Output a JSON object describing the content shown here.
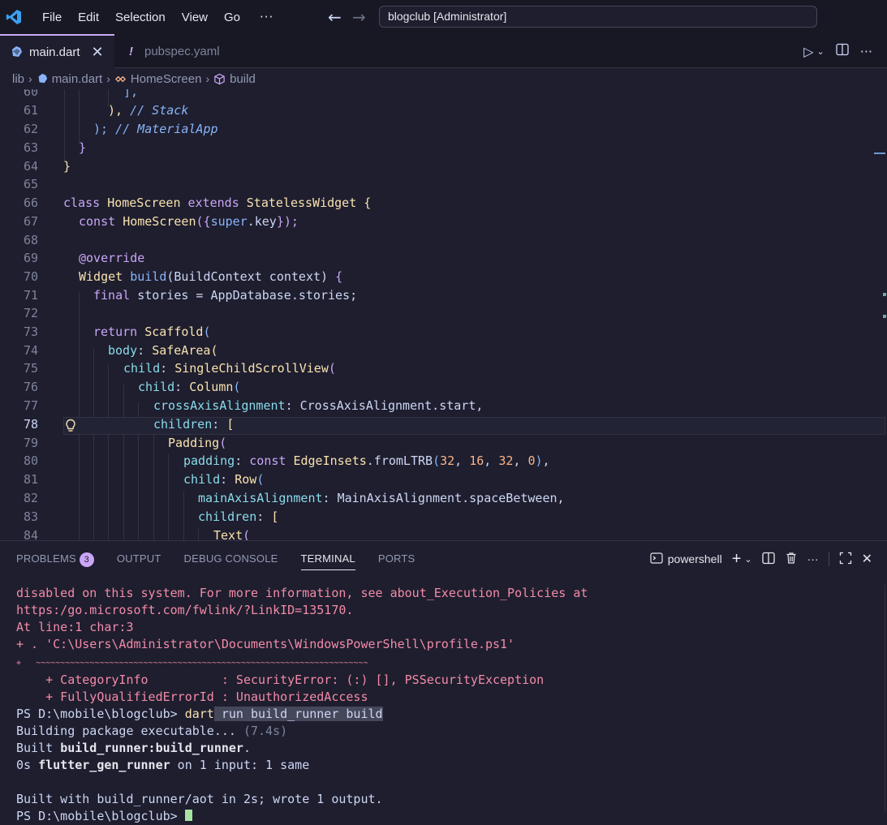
{
  "titlebar": {
    "menu": [
      "File",
      "Edit",
      "Selection",
      "View",
      "Go"
    ],
    "more": "···",
    "search_text": "blogclub [Administrator]"
  },
  "tabs": [
    {
      "label": "main.dart",
      "active": true
    },
    {
      "label": "pubspec.yaml",
      "active": false
    }
  ],
  "breadcrumb": [
    "lib",
    "main.dart",
    "HomeScreen",
    "build"
  ],
  "editor": {
    "line_numbers": [
      "60",
      "61",
      "62",
      "63",
      "64",
      "65",
      "66",
      "67",
      "68",
      "69",
      "70",
      "71",
      "72",
      "73",
      "74",
      "75",
      "76",
      "77",
      "78",
      "79",
      "80",
      "81",
      "82",
      "83",
      "84"
    ],
    "current_line": "78",
    "code": {
      "l60": "],",
      "l61_close": "),",
      "l61_comment": "// Stack",
      "l62_close": ");",
      "l62_comment": "// MaterialApp",
      "l63": "}",
      "l64": "}",
      "l66_class": "class",
      "l66_name": "HomeScreen",
      "l66_extends": "extends",
      "l66_super": "StatelessWidget",
      "l66_brace": "{",
      "l67_const": "const",
      "l67_name": "HomeScreen",
      "l67_open": "({",
      "l67_super": "super",
      "l67_key": ".key",
      "l67_close": "});",
      "l69": "@override",
      "l70_type": "Widget",
      "l70_fn": "build",
      "l70_params": "(BuildContext context)",
      "l70_brace": "{",
      "l71_final": "final",
      "l71_rest": "stories = AppDatabase.stories;",
      "l73_return": "return",
      "l73_type": "Scaffold",
      "l73_paren": "(",
      "l74_prop": "body",
      "l74_type": "SafeArea",
      "l75_prop": "child",
      "l75_type": "SingleChildScrollView",
      "l76_prop": "child",
      "l76_type": "Column",
      "l77_prop": "crossAxisAlignment",
      "l77_val": "CrossAxisAlignment.start,",
      "l78_prop": "children",
      "l78_bracket": "[",
      "l79_type": "Padding",
      "l80_prop": "padding",
      "l80_const": "const",
      "l80_type": "EdgeInsets",
      "l80_fn": ".fromLTRB",
      "l80_n1": "32",
      "l80_n2": "16",
      "l80_n3": "32",
      "l80_n4": "0",
      "l81_prop": "child",
      "l81_type": "Row",
      "l82_prop": "mainAxisAlignment",
      "l82_val": "MainAxisAlignment.spaceBetween,",
      "l83_prop": "children",
      "l83_bracket": "[",
      "l84_type": "Text"
    }
  },
  "panel": {
    "tabs": [
      "PROBLEMS",
      "OUTPUT",
      "DEBUG CONSOLE",
      "TERMINAL",
      "PORTS"
    ],
    "problems_count": "3",
    "active_tab": "TERMINAL",
    "shell_label": "powershell",
    "terminal": {
      "e1": "disabled on this system. For more information, see about_Execution_Policies at",
      "e2": "https:/go.microsoft.com/fwlink/?LinkID=135170.",
      "e3": "At line:1 char:3",
      "e4": "+ . 'C:\\Users\\Administrator\\Documents\\WindowsPowerShell\\profile.ps1'",
      "e5": "+   ~~~~~~~~~~~~~~~~~~~~~~~~~~~~~~~~~~~~~~~~~~~~~~~~~~~~~~~~~~~~~~~~~~~~",
      "e6": "    + CategoryInfo          : SecurityError: (:) [], PSSecurityException",
      "e7": "    + FullyQualifiedErrorId : UnauthorizedAccess",
      "prompt1": "PS D:\\mobile\\blogclub> ",
      "cmd1": "dart",
      "cmd1_sel": " run build_runner build",
      "o1": "Building package executable... ",
      "o1_time": "(7.4s)",
      "o2a": "Built ",
      "o2b": "build_runner:build_runner",
      "o2c": ".",
      "o3a": "0s ",
      "o3b": "flutter_gen_runner",
      "o3c": " on 1 input: 1 same",
      "o4": "Built with build_runner/aot in 2s; wrote 1 output.",
      "prompt2": "PS D:\\mobile\\blogclub> "
    }
  }
}
